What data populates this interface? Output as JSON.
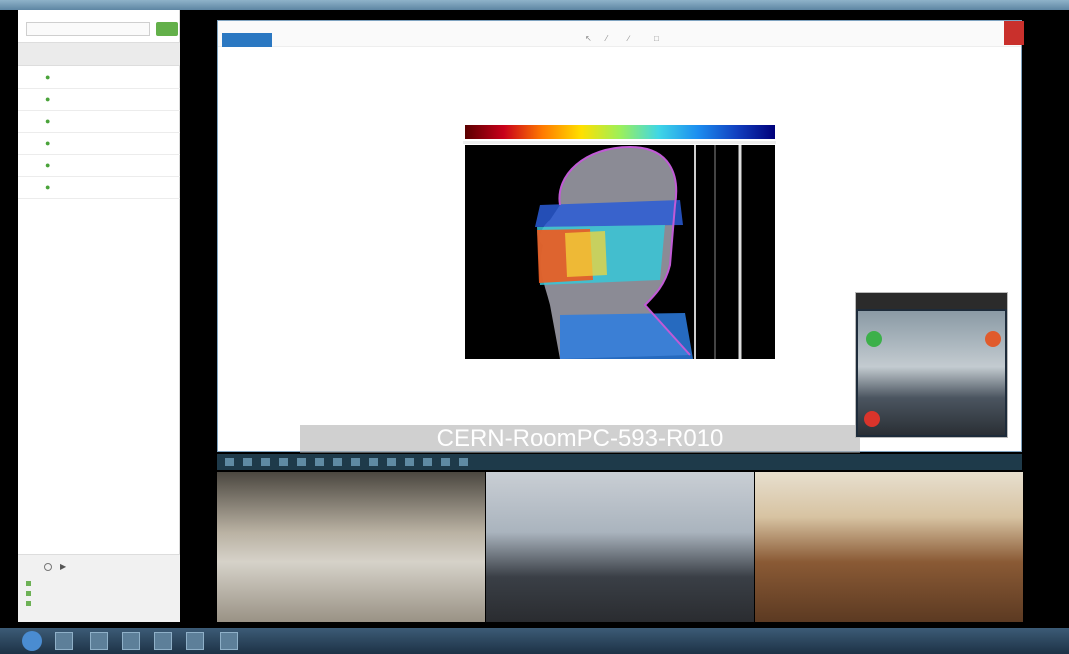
{
  "colors": {
    "accent": "#2b78c2",
    "green": "#63b04a",
    "close": "#c9302c"
  },
  "left_panel": {
    "search_placeholder": "",
    "header": "",
    "items": [
      {
        "label": ""
      },
      {
        "label": ""
      },
      {
        "label": ""
      },
      {
        "label": ""
      },
      {
        "label": ""
      },
      {
        "label": ""
      }
    ],
    "footer": [
      "",
      "",
      ""
    ]
  },
  "presentation": {
    "toolbar": {
      "home": "",
      "second": "",
      "right1": "",
      "right2": ""
    },
    "figure": {
      "colorbar_title": "",
      "ylabel": "",
      "xlabel": "",
      "xticks": [
        "",
        "",
        "",
        "",
        "",
        "",
        "",
        "",
        ""
      ],
      "rticks": [
        "",
        "",
        "",
        "",
        "",
        ""
      ]
    }
  },
  "watermark": "CERN-RoomPC-593-R010",
  "mini_window": {
    "title": ""
  },
  "videos": [
    {
      "caption": ""
    },
    {
      "caption": ""
    },
    {
      "caption": ""
    }
  ],
  "tray": {
    "time": "",
    "date": ""
  }
}
